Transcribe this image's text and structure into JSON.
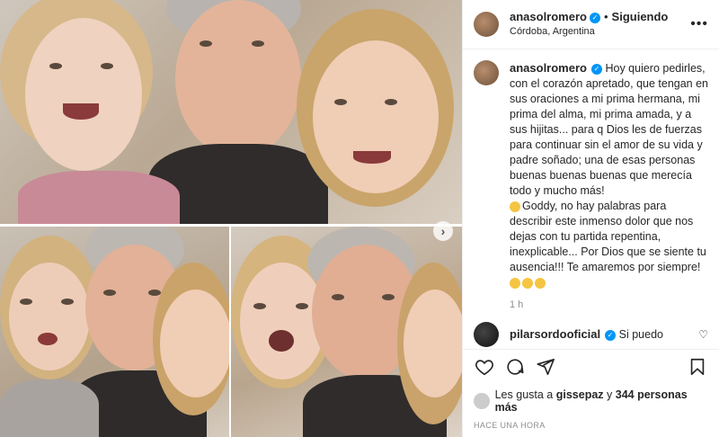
{
  "post": {
    "username": "anasolromero",
    "follow_status": "Siguiendo",
    "location": "Córdoba, Argentina",
    "caption": "Hoy quiero pedirles, con el corazón apretado, que tengan en sus oraciones a mi prima hermana, mi prima del alma, mi prima amada, y a sus hijitas... para q Dios les de fuerzas para continuar sin el amor de su vida y padre soñado; una de esas personas buenas buenas buenas que merecía todo y mucho más!",
    "caption_2": "Goddy, no hay palabras para describir este inmenso dolor que nos dejas con tu partida repentina, inexplicable... Por Dios que se siente tu ausencia!!! Te amaremos por siempre!",
    "time": "1 h"
  },
  "comment": {
    "username": "pilarsordooficial",
    "text": "Si puedo"
  },
  "likes": {
    "prefix": "Les gusta a",
    "user": "gissepaz",
    "connector": "y",
    "others": "344 personas más"
  },
  "posted_ago": "HACE UNA HORA",
  "icons": {
    "more": "more-options-icon",
    "next": "chevron-right-icon",
    "like": "heart-icon",
    "comment": "comment-icon",
    "share": "paper-plane-icon",
    "save": "bookmark-icon"
  },
  "colors": {
    "verified": "#0095f6",
    "text": "#262626",
    "muted": "#8e8e8e"
  }
}
